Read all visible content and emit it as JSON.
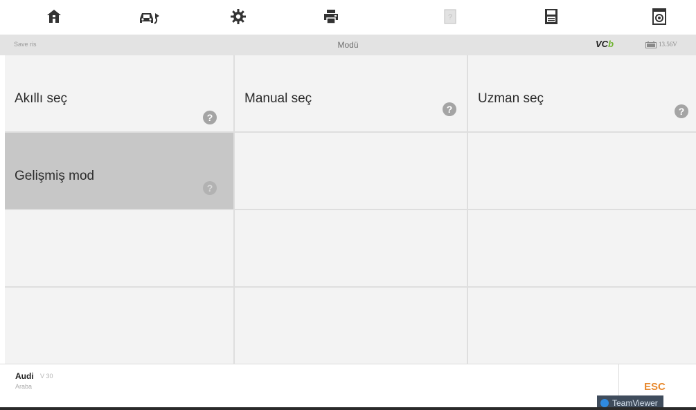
{
  "toolbar": {
    "buttons": [
      {
        "icon": "home-icon"
      },
      {
        "icon": "vehicle-swap-icon"
      },
      {
        "icon": "gear-icon"
      },
      {
        "icon": "print-icon"
      },
      {
        "icon": "help-icon",
        "disabled": true
      },
      {
        "icon": "save-icon"
      },
      {
        "icon": "screenshot-icon"
      }
    ]
  },
  "status": {
    "left_text": "Save ris",
    "title": "Modü",
    "vci_main": "VC",
    "vci_tail": "b",
    "battery_icon": "battery-icon",
    "voltage": "13.56V"
  },
  "grid": {
    "rows": [
      [
        {
          "label": "Akıllı seç",
          "help": "?"
        },
        {
          "label": "Manual seç",
          "help": "?"
        },
        {
          "label": "Uzman seç",
          "help": "?"
        }
      ],
      [
        {
          "label": "Gelişmiş mod",
          "help": "?",
          "selected": true
        },
        {
          "label": ""
        },
        {
          "label": ""
        }
      ],
      [
        {
          "label": ""
        },
        {
          "label": ""
        },
        {
          "label": ""
        }
      ],
      [
        {
          "label": ""
        },
        {
          "label": ""
        },
        {
          "label": ""
        }
      ]
    ]
  },
  "footer": {
    "make": "Audi",
    "model_extra": "V 30",
    "type": "Araba",
    "esc_label": "ESC",
    "teamviewer_label": "TeamViewer"
  },
  "colors": {
    "statusbar_bg": "#e3e3e3",
    "cell_bg": "#f3f3f3",
    "selected_bg": "#c7c7c7",
    "esc": "#e8892e",
    "vci_accent": "#6fb32f"
  }
}
